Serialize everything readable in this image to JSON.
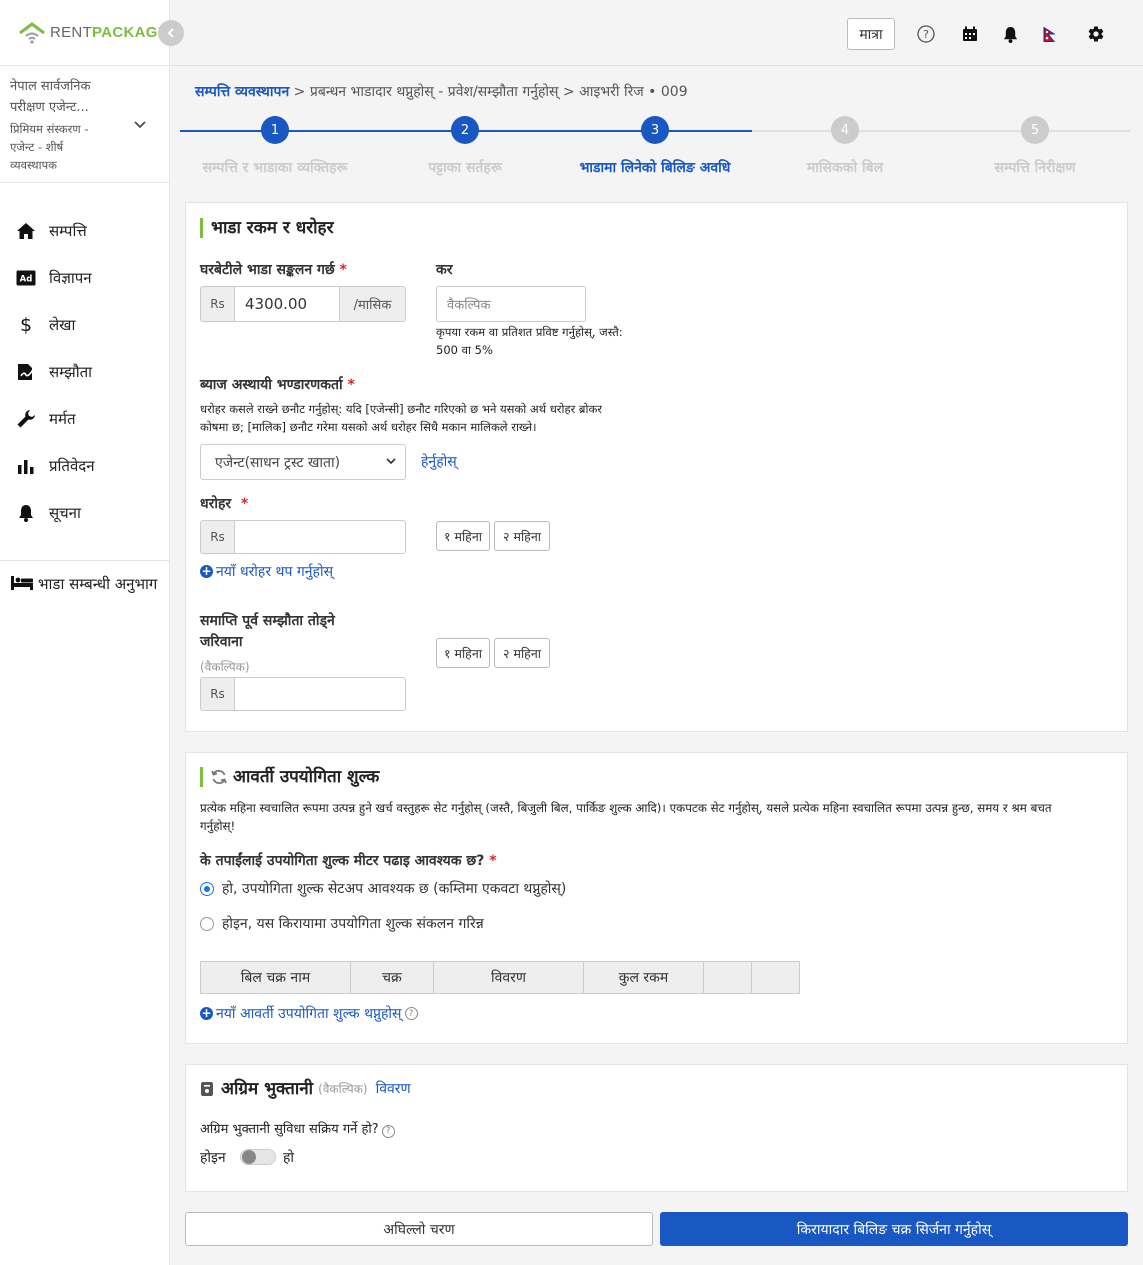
{
  "brand": {
    "text_light": "RENT",
    "text_bold": "PACKAGE"
  },
  "org": {
    "name_line1": "नेपाल सार्वजनिक",
    "name_line2": "परीक्षण एजेन्ट...",
    "plan_line1": "प्रिमियम संस्करण -",
    "plan_line2": "एजेन्ट - शीर्ष",
    "plan_line3": "व्यवस्थापक"
  },
  "nav": {
    "items": [
      {
        "label": "सम्पत्ति",
        "icon": "home-icon"
      },
      {
        "label": "विज्ञापन",
        "icon": "ad-icon"
      },
      {
        "label": "लेखा",
        "icon": "dollar-icon"
      },
      {
        "label": "सम्झौता",
        "icon": "contract-icon"
      },
      {
        "label": "मर्मत",
        "icon": "wrench-icon"
      },
      {
        "label": "प्रतिवेदन",
        "icon": "bar-chart-icon"
      },
      {
        "label": "सूचना",
        "icon": "bell-icon"
      }
    ],
    "rental_section": "भाडा सम्बन्धी अनुभाग"
  },
  "topbar": {
    "matra_label": "मात्रा"
  },
  "breadcrumb": {
    "root": "सम्पत्ति व्यवस्थापन",
    "rest": " > प्रबन्धन भाडादार थप्नुहोस् - प्रवेश/सम्झौता गर्नुहोस् > आइभरी रिज • 009"
  },
  "stepper": {
    "steps": [
      {
        "num": "1",
        "label": "सम्पत्ति र भाडाका व्यक्तिहरू",
        "state": "done"
      },
      {
        "num": "2",
        "label": "पट्टाका सर्तहरू",
        "state": "done"
      },
      {
        "num": "3",
        "label": "भाडामा लिनेको बिलिङ अवधि",
        "state": "active"
      },
      {
        "num": "4",
        "label": "मासिकको बिल",
        "state": "todo"
      },
      {
        "num": "5",
        "label": "सम्पत्ति निरीक्षण",
        "state": "todo"
      }
    ]
  },
  "rent": {
    "title": "भाडा रकम र धरोहर",
    "collect_label": "घरबेटीले भाडा सङ्कलन गर्छ",
    "currency": "Rs",
    "amount": "4300.00",
    "period": "/मासिक",
    "tax_label": "कर",
    "tax_placeholder": "वैकल्पिक",
    "tax_hint_line1": "कृपया रकम वा प्रतिशत प्रविष्ट गर्नुहोस्, जस्तै:",
    "tax_hint_line2": "500 वा 5%",
    "holder_label": "ब्याज अस्थायी भण्डारणकर्ता",
    "holder_desc_line1": "धरोहर कसले राख्ने छनौट गर्नुहोस्: यदि [एजेन्सी] छनौट गरिएको छ भने यसको अर्थ धरोहर ब्रोकर",
    "holder_desc_line2": "कोषमा छ; [मालिक] छनौट गरेमा यसको अर्थ धरोहर सिधै मकान मालिकले राख्ने।",
    "holder_selected": "एजेन्ट(साधन ट्रस्ट खाता)",
    "view_link": "हेर्नुहोस्",
    "deposit_label": "धरोहर",
    "one_month": "१ महिना",
    "two_month": "२ महिना",
    "add_deposit": "नयाँ धरोहर थप गर्नुहोस्",
    "penalty_label_line1": "समाप्ति पूर्व सम्झौता तोड्ने",
    "penalty_label_line2": "जरिवाना",
    "optional": "(वैकल्पिक)"
  },
  "utility": {
    "title": "आवर्ती उपयोगिता शुल्क",
    "desc_line1": "प्रत्येक महिना स्वचालित रूपमा उत्पन्न हुने खर्च वस्तुहरू सेट गर्नुहोस् (जस्तै, बिजुली बिल, पार्किङ शुल्क आदि)। एकपटक सेट गर्नुहोस्, यसले प्रत्येक महिना स्वचालित रूपमा उत्पन्न हुन्छ, समय र श्रम बचत",
    "desc_line2": "गर्नुहोस्!",
    "question": "के तपाईंलाई उपयोगिता शुल्क मीटर पढाइ आवश्यक छ?",
    "opt_yes": "हो, उपयोगिता शुल्क सेटअप आवश्यक छ (कम्तिमा एकवटा थप्नुहोस्)",
    "opt_no": "होइन, यस किरायामा उपयोगिता शुल्क संकलन गरिन्न",
    "selected": "yes",
    "columns": [
      "बिल चक्र नाम",
      "चक्र",
      "विवरण",
      "कुल रकम",
      "",
      ""
    ],
    "add_link": "नयाँ आवर्ती उपयोगिता शुल्क थप्नुहोस्"
  },
  "advance": {
    "title": "अग्रिम भुक्तानी",
    "optional": "(वैकल्पिक)",
    "details_link": "विवरण",
    "question": "अग्रिम भुक्तानी सुविधा सक्रिय गर्ने हो?",
    "off_label": "होइन",
    "on_label": "हो",
    "enabled": false
  },
  "footer": {
    "prev": "अघिल्लो चरण",
    "create": "किरायादार बिलिङ चक्र सिर्जना गर्नुहोस्"
  },
  "colors": {
    "accent": "#1957c2",
    "brand_green": "#7cbf3a",
    "required": "#d9262a"
  }
}
